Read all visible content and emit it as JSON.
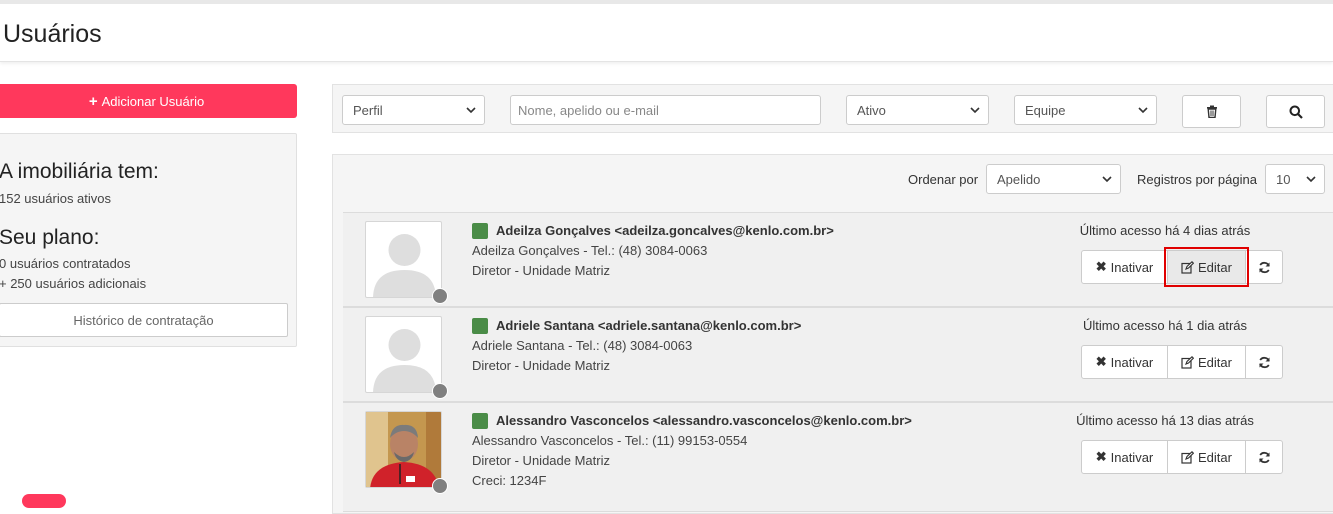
{
  "page": {
    "title": "Usuários"
  },
  "sidebar": {
    "add_button_label": "Adicionar Usuário",
    "summary_heading": "A imobiliária tem:",
    "active_users": "152 usuários ativos",
    "plan_heading": "Seu plano:",
    "contracted_users": "0 usuários contratados",
    "additional_users": "+ 250 usuários adicionais",
    "history_button_label": "Histórico de contratação"
  },
  "filters": {
    "profile_select": "Perfil",
    "search_placeholder": "Nome, apelido ou e-mail",
    "status_select": "Ativo",
    "team_select": "Equipe"
  },
  "list": {
    "order_by_label": "Ordenar por",
    "order_by_value": "Apelido",
    "per_page_label": "Registros por página",
    "per_page_value": "10",
    "users": [
      {
        "title": "Adeilza Gonçalves <adeilza.goncalves@kenlo.com.br>",
        "contact": "Adeilza Gonçalves - Tel.: (48) 3084-0063",
        "role": "Diretor  - Unidade Matriz",
        "last_access": "Último acesso há 4 dias atrás",
        "inactivate_label": "Inativar",
        "edit_label": "Editar"
      },
      {
        "title": "Adriele Santana <adriele.santana@kenlo.com.br>",
        "contact": "Adriele Santana - Tel.: (48) 3084-0063",
        "role": "Diretor  - Unidade Matriz",
        "last_access": "Último acesso há 1 dia atrás",
        "inactivate_label": "Inativar",
        "edit_label": "Editar"
      },
      {
        "title": "Alessandro Vasconcelos <alessandro.vasconcelos@kenlo.com.br>",
        "contact": "Alessandro Vasconcelos - Tel.: (11) 99153-0554",
        "role": "Diretor  - Unidade Matriz",
        "creci": "Creci: 1234F",
        "last_access": "Último acesso há 13 dias atrás",
        "inactivate_label": "Inativar",
        "edit_label": "Editar"
      }
    ]
  },
  "colors": {
    "accent": "#ff385c",
    "active_status": "#4a8c47",
    "highlight": "#e00000"
  }
}
